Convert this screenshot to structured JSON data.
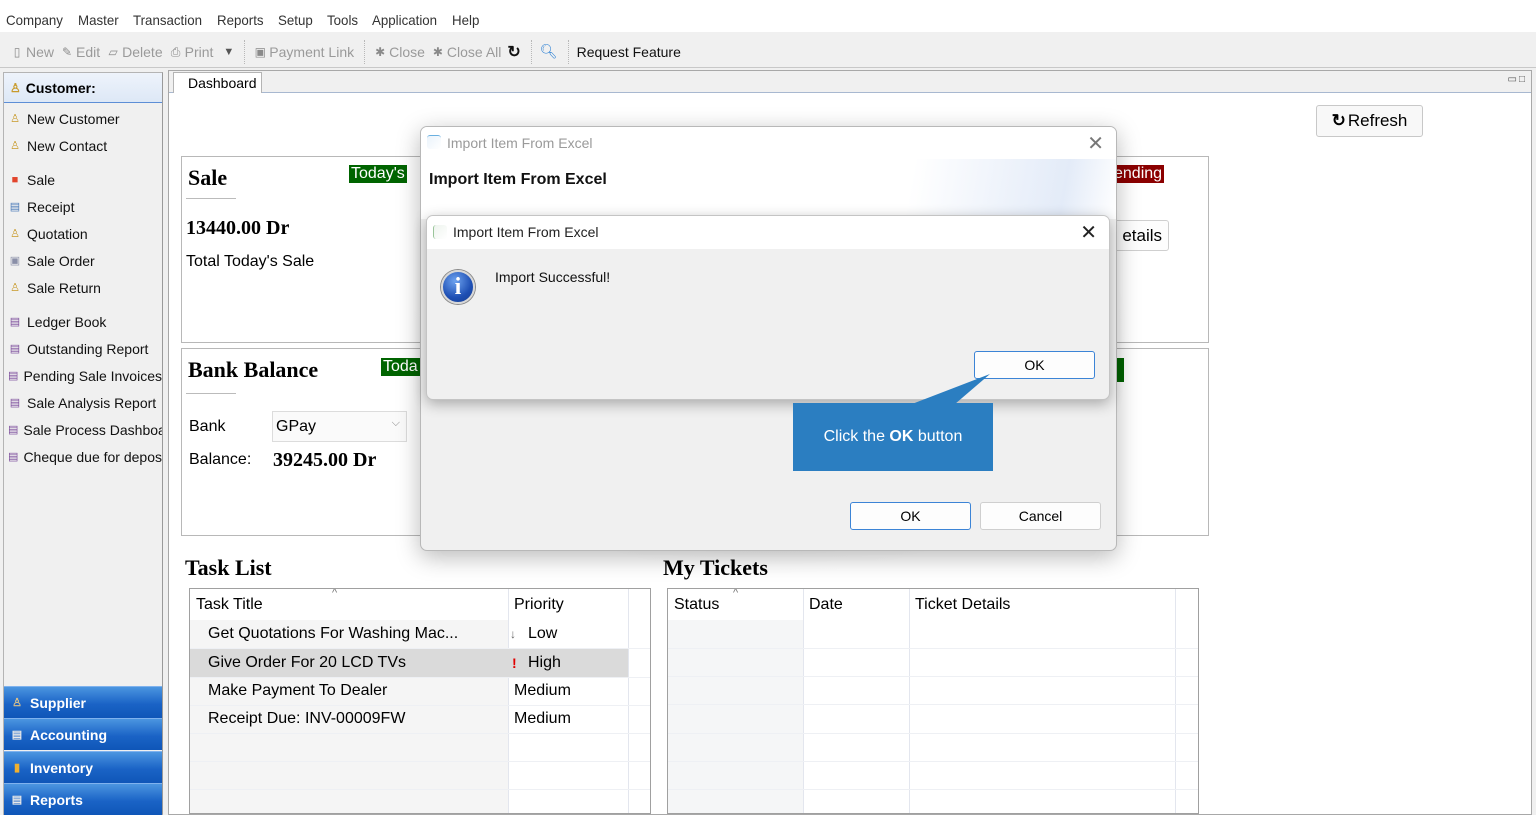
{
  "menu": [
    "Company",
    "Master",
    "Transaction",
    "Reports",
    "Setup",
    "Tools",
    "Application",
    "Help"
  ],
  "toolbar": {
    "new": "New",
    "edit": "Edit",
    "delete": "Delete",
    "print": "Print",
    "payment_link": "Payment Link",
    "close": "Close",
    "close_all": "Close All",
    "request_feature": "Request Feature"
  },
  "sidebar": {
    "header": "Customer:",
    "items": [
      {
        "label": "New Customer",
        "icon": "customer-icon"
      },
      {
        "label": "New Contact",
        "icon": "contact-icon"
      },
      {
        "label": "Sale",
        "icon": "sale-icon"
      },
      {
        "label": "Receipt",
        "icon": "receipt-icon"
      },
      {
        "label": "Quotation",
        "icon": "quotation-icon"
      },
      {
        "label": "Sale Order",
        "icon": "sale-order-icon"
      },
      {
        "label": "Sale Return",
        "icon": "sale-return-icon"
      },
      {
        "label": "Ledger Book",
        "icon": "report-icon"
      },
      {
        "label": "Outstanding Report",
        "icon": "report-icon"
      },
      {
        "label": "Pending Sale Invoices",
        "icon": "report-icon"
      },
      {
        "label": "Sale Analysis Report",
        "icon": "report-icon"
      },
      {
        "label": "Sale Process Dashboa",
        "icon": "report-icon"
      },
      {
        "label": "Cheque due for depos",
        "icon": "report-icon"
      }
    ],
    "sections": [
      "Supplier",
      "Accounting",
      "Inventory",
      "Reports"
    ]
  },
  "tabs": {
    "dashboard": "Dashboard"
  },
  "dashboard": {
    "refresh": "Refresh",
    "sale": {
      "title": "Sale",
      "badge": "Today's",
      "amount": "13440.00 Dr",
      "caption": "Total Today's Sale"
    },
    "pending": {
      "badge": "ending",
      "details_button": "etails"
    },
    "bank": {
      "title": "Bank Balance",
      "badge": "Toda",
      "bank_label": "Bank",
      "bank_selected": "GPay",
      "balance_label": "Balance:",
      "balance_value": "39245.00 Dr"
    },
    "task_list": {
      "title": "Task List",
      "columns": [
        "Task Title",
        "Priority"
      ],
      "rows": [
        {
          "title": "Get Quotations For Washing Mac...",
          "priority": "Low",
          "priority_icon": "↓"
        },
        {
          "title": "Give Order For 20 LCD TVs",
          "priority": "High",
          "priority_icon": "!"
        },
        {
          "title": "Make Payment To Dealer",
          "priority": "Medium",
          "priority_icon": ""
        },
        {
          "title": "Receipt Due: INV-00009FW",
          "priority": "Medium",
          "priority_icon": ""
        }
      ]
    },
    "tickets": {
      "title": "My Tickets",
      "columns": [
        "Status",
        "Date",
        "Ticket Details"
      ]
    }
  },
  "outer_dialog": {
    "title": "Import Item From Excel",
    "heading": "Import Item From Excel",
    "ok": "OK",
    "cancel": "Cancel"
  },
  "message_box": {
    "title": "Import Item From Excel",
    "message": "Import Successful!",
    "ok": "OK"
  },
  "callout": {
    "prefix": "Click the ",
    "bold": "OK",
    "suffix": " button",
    "color": "#2b7ec1"
  },
  "colors": {
    "badge_green": "#006400",
    "badge_red": "#8b0000",
    "sidebar_section": "#1a63c6"
  }
}
